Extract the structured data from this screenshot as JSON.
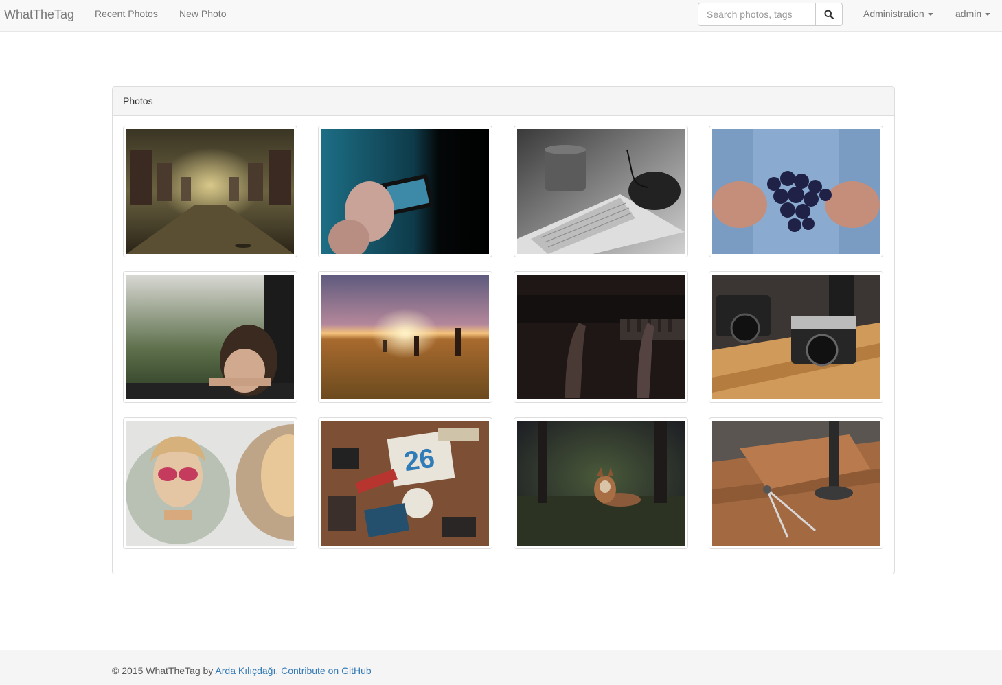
{
  "navbar": {
    "brand": "WhatTheTag",
    "links": [
      "Recent Photos",
      "New Photo"
    ],
    "search_placeholder": "Search photos, tags",
    "administration_label": "Administration",
    "user_label": "admin"
  },
  "panel": {
    "title": "Photos",
    "photos": [
      {
        "subject": "empty tram interior"
      },
      {
        "subject": "hand holding phone camera"
      },
      {
        "subject": "keyboard, mouse and mug"
      },
      {
        "subject": "hands holding grapes"
      },
      {
        "subject": "child looking out rainy window"
      },
      {
        "subject": "sunset over wheat field"
      },
      {
        "subject": "hands on piano keys"
      },
      {
        "subject": "vintage cameras on table"
      },
      {
        "subject": "woman with sunglasses portrait"
      },
      {
        "subject": "designer desk flatlay"
      },
      {
        "subject": "fox in forest"
      },
      {
        "subject": "compass on wooden desk"
      }
    ]
  },
  "footer": {
    "prefix": "© 2015 WhatTheTag by ",
    "author": "Arda Kılıçdağı",
    "separator": ", ",
    "github": "Contribute on GitHub"
  },
  "colors": {
    "link": "#337ab7",
    "nav_text": "#777777",
    "navbar_bg": "#f8f8f8"
  }
}
